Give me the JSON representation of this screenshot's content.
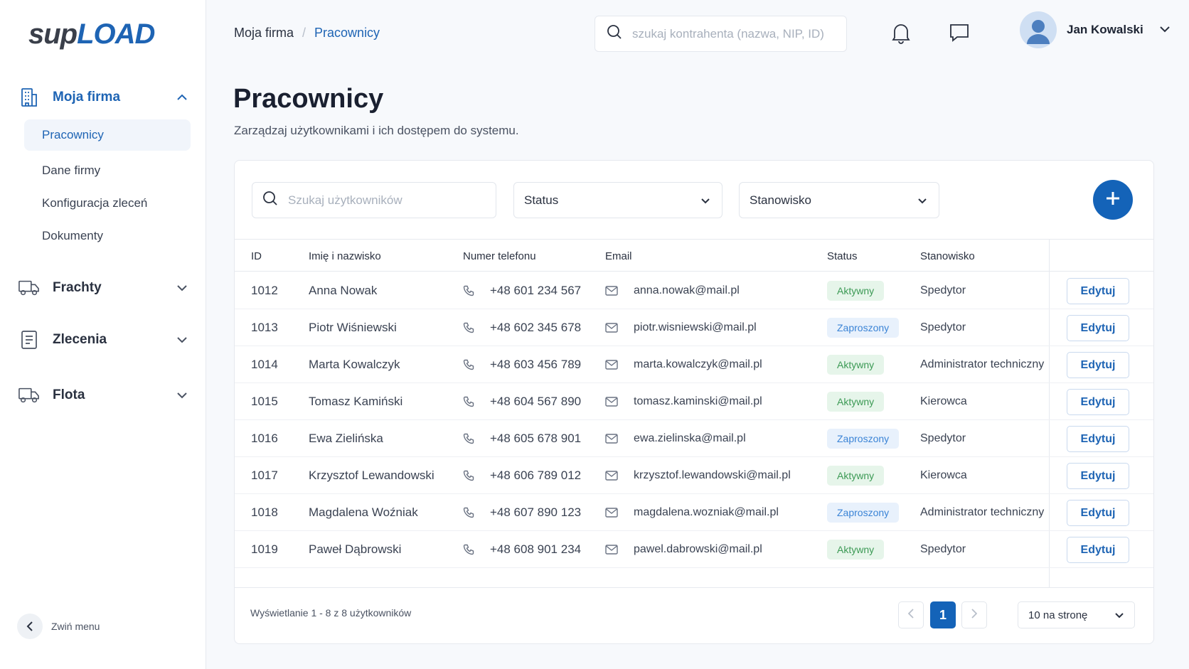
{
  "brand": {
    "part1": "sup",
    "part2": "LOAD"
  },
  "sidebar": {
    "groups": [
      {
        "label": "Moja firma",
        "expanded": true,
        "icon": "building-icon"
      },
      {
        "label": "Frachty",
        "expanded": false,
        "icon": "truck-icon"
      },
      {
        "label": "Zlecenia",
        "expanded": false,
        "icon": "document-icon"
      },
      {
        "label": "Flota",
        "expanded": false,
        "icon": "truck-icon"
      }
    ],
    "sub_items": [
      "Pracownicy",
      "Dane firmy",
      "Konfiguracja zleceń",
      "Dokumenty"
    ],
    "active_sub": "Pracownicy",
    "collapse_label": "Zwiń menu"
  },
  "topbar": {
    "breadcrumb": [
      "Moja firma",
      "Pracownicy"
    ],
    "search_placeholder": "szukaj kontrahenta (nazwa, NIP, ID)",
    "user_name": "Jan Kowalski"
  },
  "page": {
    "title": "Pracownicy",
    "subtitle": "Zarządzaj użytkownikami i ich dostępem do systemu."
  },
  "filters": {
    "search_placeholder": "Szukaj użytkowników",
    "status_label": "Status",
    "position_label": "Stanowisko"
  },
  "table": {
    "headers": [
      "ID",
      "Imię i nazwisko",
      "Numer telefonu",
      "Email",
      "Status",
      "Stanowisko"
    ],
    "edit_label": "Edytuj",
    "rows": [
      {
        "id": "1012",
        "name": "Anna Nowak",
        "phone": "+48 601 234 567",
        "email": "anna.nowak@mail.pl",
        "status": "Aktywny",
        "position": "Spedytor"
      },
      {
        "id": "1013",
        "name": "Piotr Wiśniewski",
        "phone": "+48 602 345 678",
        "email": "piotr.wisniewski@mail.pl",
        "status": "Zaproszony",
        "position": "Spedytor"
      },
      {
        "id": "1014",
        "name": "Marta Kowalczyk",
        "phone": "+48 603 456 789",
        "email": "marta.kowalczyk@mail.pl",
        "status": "Aktywny",
        "position": "Administrator techniczny"
      },
      {
        "id": "1015",
        "name": "Tomasz Kamiński",
        "phone": "+48 604 567 890",
        "email": "tomasz.kaminski@mail.pl",
        "status": "Aktywny",
        "position": "Kierowca"
      },
      {
        "id": "1016",
        "name": "Ewa Zielińska",
        "phone": "+48 605 678 901",
        "email": "ewa.zielinska@mail.pl",
        "status": "Zaproszony",
        "position": "Spedytor"
      },
      {
        "id": "1017",
        "name": "Krzysztof Lewandowski",
        "phone": "+48 606 789 012",
        "email": "krzysztof.lewandowski@mail.pl",
        "status": "Aktywny",
        "position": "Kierowca"
      },
      {
        "id": "1018",
        "name": "Magdalena Woźniak",
        "phone": "+48 607 890 123",
        "email": "magdalena.wozniak@mail.pl",
        "status": "Zaproszony",
        "position": "Administrator techniczny"
      },
      {
        "id": "1019",
        "name": "Paweł Dąbrowski",
        "phone": "+48 608 901 234",
        "email": "pawel.dabrowski@mail.pl",
        "status": "Aktywny",
        "position": "Spedytor"
      }
    ]
  },
  "pagination": {
    "showing": "Wyświetlanie 1 - 8 z 8 użytkowników",
    "current_page": "1",
    "per_page": "10 na stronę"
  },
  "colors": {
    "primary": "#1463b8",
    "active_badge_bg": "#e6f5ea",
    "active_badge_text": "#3c9a55",
    "invited_badge_bg": "#e8f1fc",
    "invited_badge_text": "#3b84d6"
  }
}
